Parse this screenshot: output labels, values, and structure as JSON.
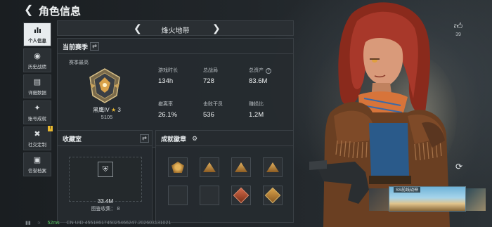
{
  "header": {
    "back_icon": "chevron-left-icon",
    "title": "角色信息"
  },
  "nav": {
    "items": [
      {
        "label": "个人信息",
        "icon": "bar-chart-icon",
        "active": true
      },
      {
        "label": "历史战绩",
        "icon": "record-icon",
        "active": false
      },
      {
        "label": "详细数据",
        "icon": "data-card-icon",
        "active": false
      },
      {
        "label": "账号成就",
        "icon": "medal-icon",
        "active": false
      },
      {
        "label": "社交定制",
        "icon": "tools-icon",
        "active": false,
        "badge": "!"
      },
      {
        "label": "信誉档案",
        "icon": "profile-icon",
        "active": false
      }
    ]
  },
  "map_selector": {
    "name": "烽火地带"
  },
  "season": {
    "title": "当前赛季",
    "best_label": "赛季最高",
    "rank_name": "黑鹰IV",
    "rank_stars": "3",
    "rank_score": "5105",
    "stats": [
      {
        "label": "游戏时长",
        "value": "134h"
      },
      {
        "label": "总战局",
        "value": "728"
      },
      {
        "label": "总资产",
        "value": "83.6M",
        "help": "?"
      },
      {
        "label": "撤离率",
        "value": "26.1%"
      },
      {
        "label": "击败干员",
        "value": "536"
      },
      {
        "label": "赚损比",
        "value": "1.2M"
      }
    ]
  },
  "collection": {
    "title": "收藏室",
    "value": "33.4M",
    "count_label": "图鉴收集：",
    "count_value": "8"
  },
  "achievements": {
    "title": "成就徽章"
  },
  "likes": {
    "icon": "thumbs-up-icon",
    "count": "39"
  },
  "skin": {
    "tag": "SS前线战神"
  },
  "footer": {
    "fps": "52ms",
    "uid": "CN UID 4551861745025466247.202603131021"
  },
  "colors": {
    "accent": "#e8ecee",
    "gold": "#d9a24a",
    "panel": "#262b2f"
  }
}
